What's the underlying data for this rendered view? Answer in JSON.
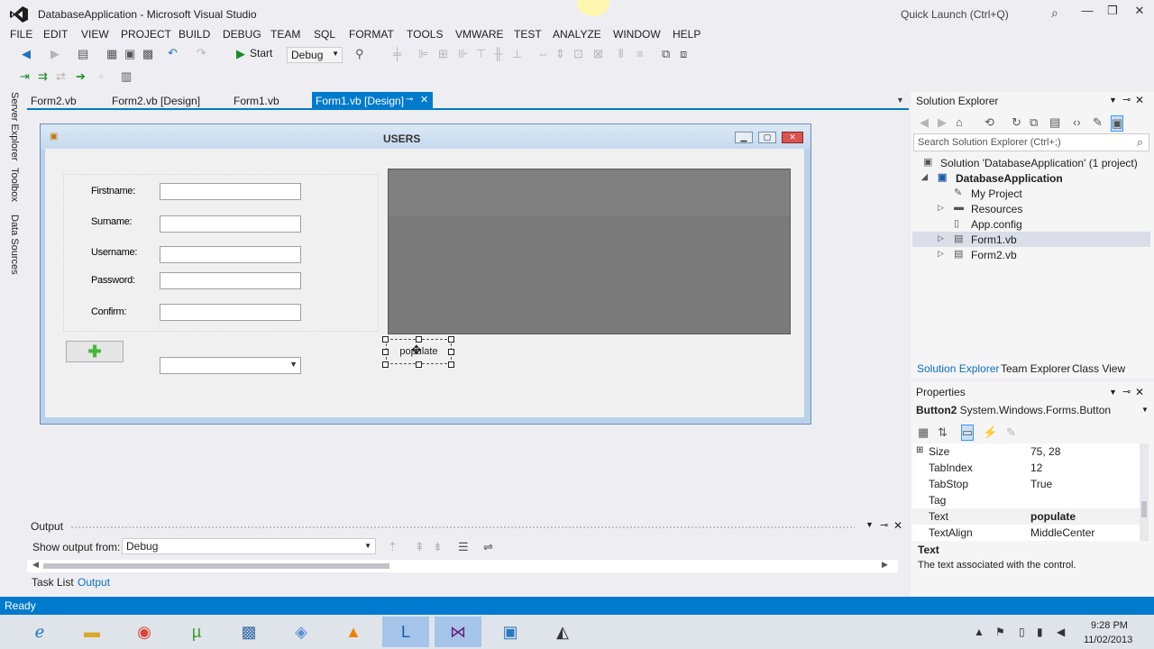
{
  "app": {
    "title": "DatabaseApplication - Microsoft Visual Studio",
    "quick_launch_placeholder": "Quick Launch (Ctrl+Q)"
  },
  "menu": [
    "FILE",
    "EDIT",
    "VIEW",
    "PROJECT",
    "BUILD",
    "DEBUG",
    "TEAM",
    "SQL",
    "FORMAT",
    "TOOLS",
    "VMWARE",
    "TEST",
    "ANALYZE",
    "WINDOW",
    "HELP"
  ],
  "toolbar": {
    "start_label": "Start",
    "config_value": "Debug"
  },
  "left_tabs": [
    "Server Explorer",
    "Toolbox",
    "Data Sources"
  ],
  "doc_tabs": [
    {
      "label": "Form2.vb"
    },
    {
      "label": "Form2.vb [Design]"
    },
    {
      "label": "Form1.vb"
    },
    {
      "label": "Form1.vb [Design]",
      "active": true
    }
  ],
  "form": {
    "title": "USERS",
    "labels": {
      "firstname": "Firstname:",
      "surname": "Surname:",
      "username": "Username:",
      "password": "Password:",
      "confirm": "Confirm:"
    },
    "add_button_icon": "plus-icon",
    "populate_button_label": "populate"
  },
  "output": {
    "title": "Output",
    "show_output_label": "Show output from:",
    "source_value": "Debug",
    "tabs": [
      "Task List",
      "Output"
    ]
  },
  "solution_explorer": {
    "title": "Solution Explorer",
    "search_placeholder": "Search Solution Explorer (Ctrl+;)",
    "tree": [
      {
        "label": "Solution 'DatabaseApplication' (1 project)",
        "icon": "solution-icon"
      },
      {
        "label": "DatabaseApplication",
        "icon": "vb-project-icon"
      },
      {
        "label": "My Project",
        "icon": "wrench-icon"
      },
      {
        "label": "Resources",
        "icon": "folder-icon"
      },
      {
        "label": "App.config",
        "icon": "config-file-icon"
      },
      {
        "label": "Form1.vb",
        "icon": "form-icon",
        "selected": true
      },
      {
        "label": "Form2.vb",
        "icon": "form-icon"
      }
    ],
    "bottom_tabs": [
      "Solution Explorer",
      "Team Explorer",
      "Class View"
    ]
  },
  "properties": {
    "title": "Properties",
    "object_name": "Button2",
    "object_type": "System.Windows.Forms.Button",
    "rows": [
      {
        "name": "Size",
        "value": "75, 28"
      },
      {
        "name": "TabIndex",
        "value": "12"
      },
      {
        "name": "TabStop",
        "value": "True"
      },
      {
        "name": "Tag",
        "value": ""
      },
      {
        "name": "Text",
        "value": "populate"
      },
      {
        "name": "TextAlign",
        "value": "MiddleCenter"
      }
    ],
    "desc_title": "Text",
    "desc": "The text associated with the control."
  },
  "status": {
    "text": "Ready"
  },
  "taskbar": {
    "apps": [
      "ie-icon",
      "explorer-icon",
      "chrome-icon",
      "utorrent-icon",
      "python-icon",
      "box-icon",
      "vlc-icon",
      "lync-icon",
      "visual-studio-icon",
      "rdp-icon",
      "tool-icon"
    ],
    "time": "9:28 PM",
    "date": "11/02/2013"
  },
  "colors": {
    "accent": "#007acc",
    "grid_panel": "#7a7a7a",
    "add_icon": "#48b83c"
  }
}
